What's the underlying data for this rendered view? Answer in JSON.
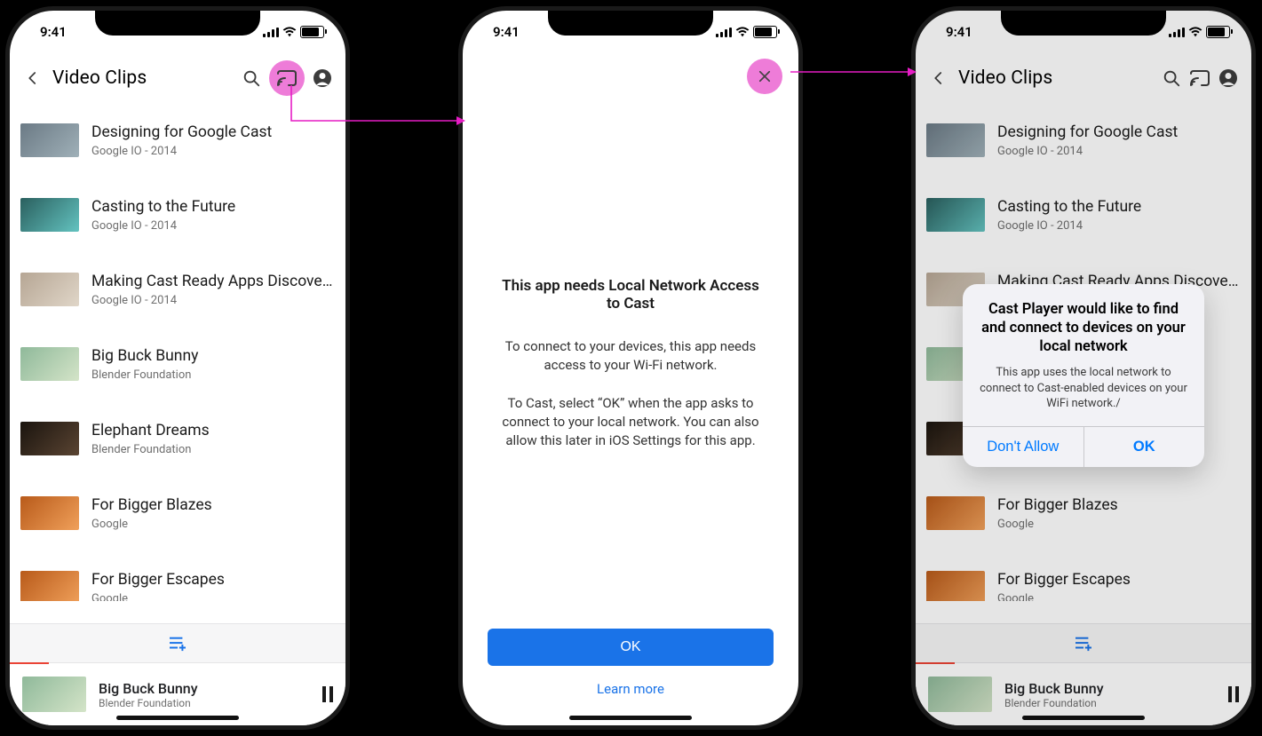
{
  "status_time": "9:41",
  "header": {
    "title": "Video Clips"
  },
  "videos": [
    {
      "title": "Designing for Google Cast",
      "sub": "Google IO - 2014",
      "thumb": "#9fb0b8"
    },
    {
      "title": "Casting to the Future",
      "sub": "Google IO - 2014",
      "thumb": "#63c3c0"
    },
    {
      "title": "Making Cast Ready Apps Discoverable",
      "sub": "Google IO - 2014",
      "thumb": "#c9b9a8"
    },
    {
      "title": "Big Buck Bunny",
      "sub": "Blender Foundation",
      "thumb": "#a7c68f"
    },
    {
      "title": "Elephant Dreams",
      "sub": "Blender Foundation",
      "thumb": "#3a2d22"
    },
    {
      "title": "For Bigger Blazes",
      "sub": "Google",
      "thumb": "#d97a2f"
    },
    {
      "title": "For Bigger Escapes",
      "sub": "Google",
      "thumb": "#d97a2f"
    }
  ],
  "nowplaying": {
    "title": "Big Buck Bunny",
    "sub": "Blender Foundation"
  },
  "interstitial": {
    "title": "This app needs Local Network Access to Cast",
    "para1": "To connect to your devices, this app needs access to your Wi-Fi network.",
    "para2": "To Cast, select “OK” when the app asks to connect to your local network. You can also allow this later in iOS Settings for this app.",
    "ok": "OK",
    "learn": "Learn more"
  },
  "dialog": {
    "title": "Cast Player would like to find and connect to devices on your local network",
    "body": "This app uses the local network to connect to Cast-enabled devices on your WiFi network./",
    "dont": "Don't Allow",
    "ok": "OK"
  }
}
